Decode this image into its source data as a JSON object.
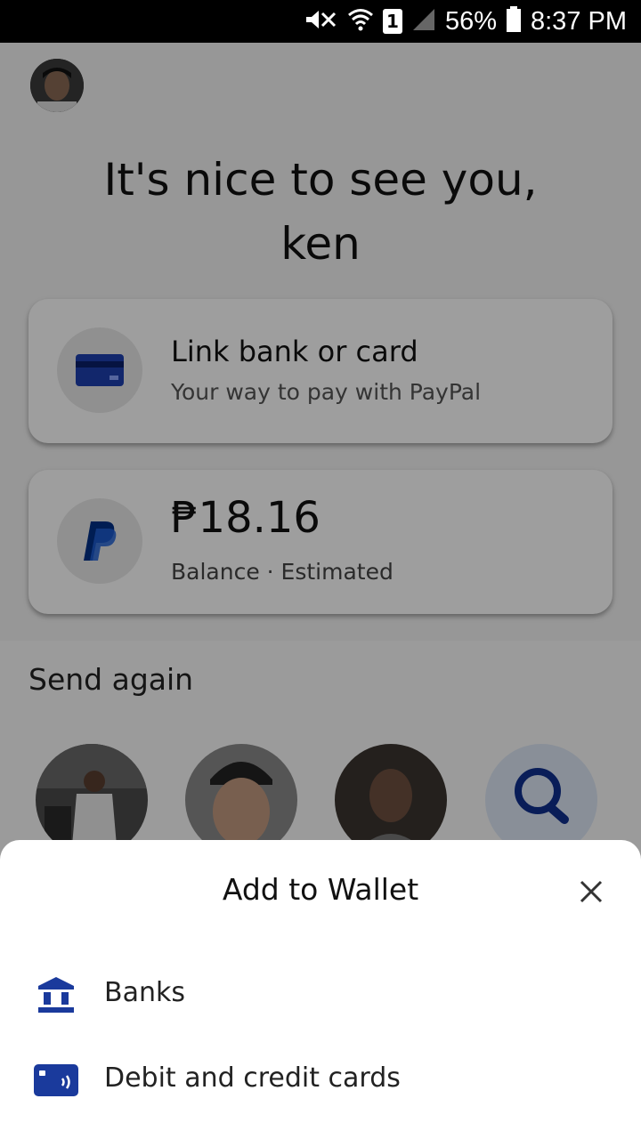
{
  "status_bar": {
    "battery": "56%",
    "time": "8:37 PM",
    "sim_slot": "1",
    "icons": [
      "mute-icon",
      "wifi-icon",
      "sim-icon",
      "signal-icon",
      "battery-icon"
    ]
  },
  "greeting": {
    "line1": "It's nice to see you,",
    "line2": "ken"
  },
  "link_card": {
    "title": "Link bank or card",
    "subtitle": "Your way to pay with PayPal",
    "icon": "credit-card-icon"
  },
  "balance_card": {
    "amount": "₱18.16",
    "subtitle": "Balance · Estimated",
    "icon": "paypal-logo-icon"
  },
  "send_again": {
    "title": "Send again",
    "contacts": [
      "contact-1",
      "contact-2",
      "contact-3"
    ],
    "search_icon": "search-icon"
  },
  "sheet": {
    "title": "Add to Wallet",
    "options": [
      {
        "label": "Banks",
        "icon": "bank-icon"
      },
      {
        "label": "Debit and credit cards",
        "icon": "card-icon"
      }
    ]
  },
  "colors": {
    "accent": "#0f2f8f",
    "paypal_dark": "#003087",
    "paypal_light": "#009cde"
  }
}
